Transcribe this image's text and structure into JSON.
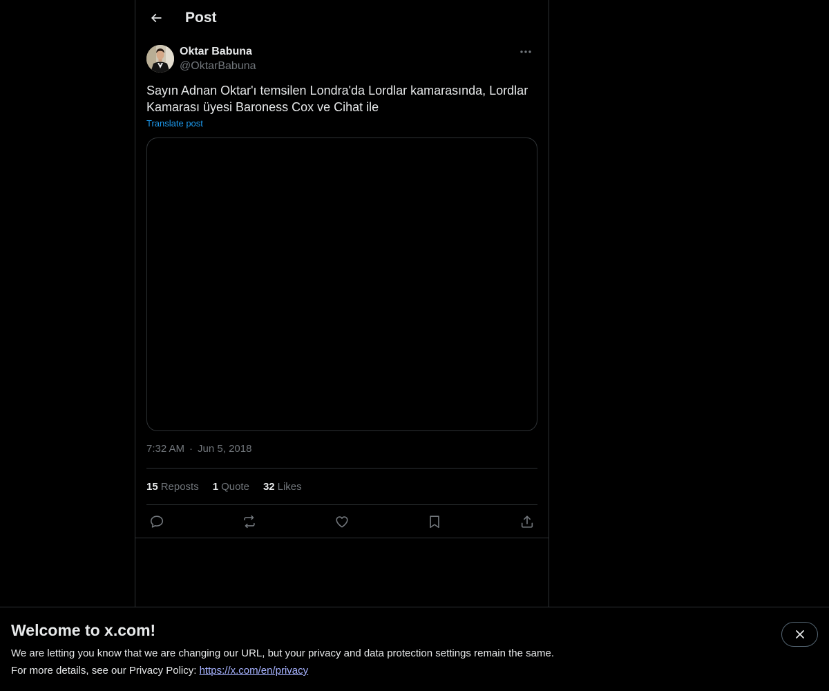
{
  "header": {
    "title": "Post",
    "back_icon": "arrow-left-icon"
  },
  "post": {
    "author": {
      "display_name": "Oktar Babuna",
      "handle": "@OktarBabuna"
    },
    "text": "Sayın Adnan Oktar'ı temsilen Londra'da Lordlar kamarasında, Lordlar Kamarası üyesi Baroness Cox ve Cihat ile",
    "translate_label": "Translate post",
    "time": "7:32 AM",
    "separator": "·",
    "date": "Jun 5, 2018",
    "stats": {
      "reposts_count": "15",
      "reposts_label": "Reposts",
      "quotes_count": "1",
      "quotes_label": "Quote",
      "likes_count": "32",
      "likes_label": "Likes"
    },
    "actions": [
      "reply-icon",
      "repost-icon",
      "like-icon",
      "bookmark-icon",
      "share-icon"
    ]
  },
  "banner": {
    "title": "Welcome to x.com!",
    "line1": "We are letting you know that we are changing our URL, but your privacy and data protection settings remain the same.",
    "line2_prefix": "For more details, see our Privacy Policy: ",
    "link_text": "https://x.com/en/privacy"
  },
  "colors": {
    "background": "#000000",
    "text_primary": "#e7e9ea",
    "text_secondary": "#71767b",
    "accent": "#1d9bf0",
    "border": "#2f3336",
    "link": "#a6b2ff"
  }
}
